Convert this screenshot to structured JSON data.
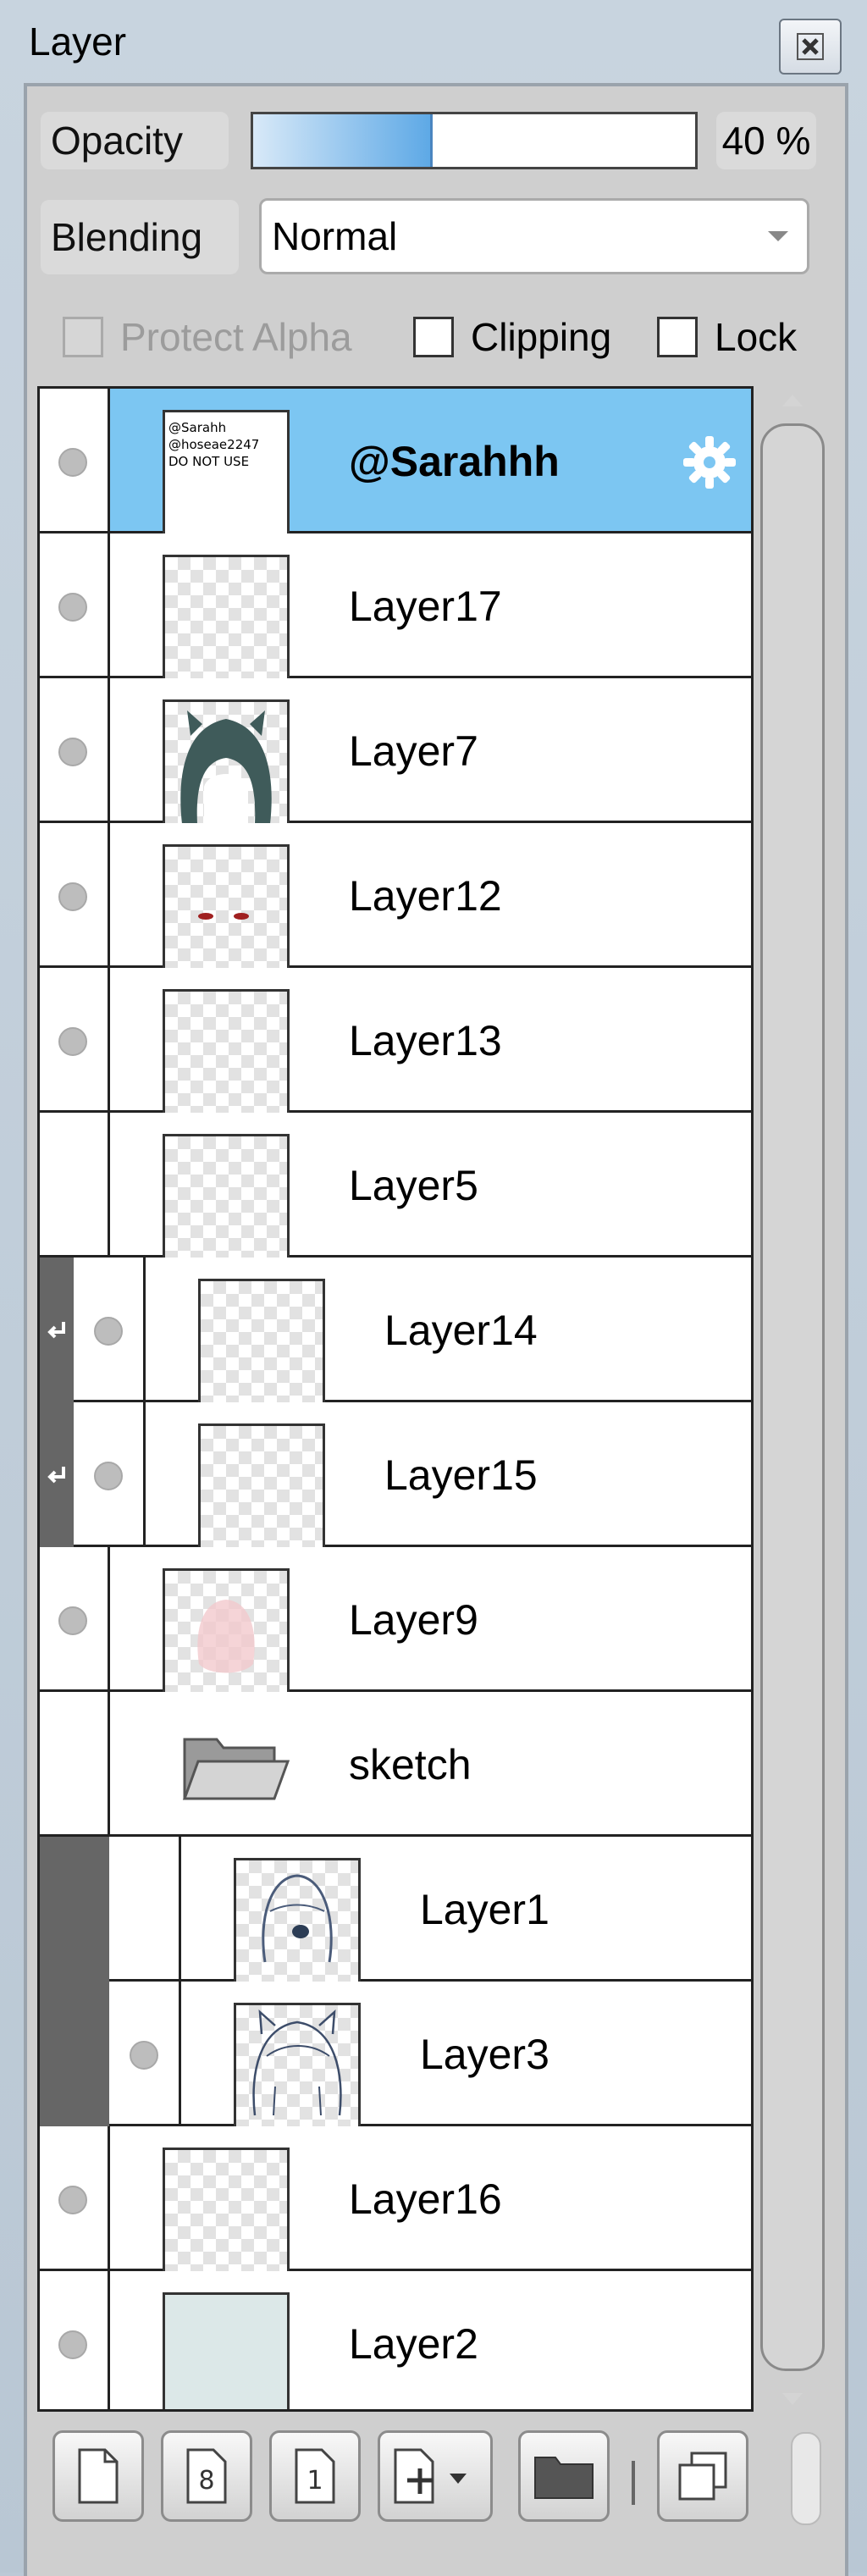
{
  "window": {
    "title": "Layer"
  },
  "controls": {
    "opacity_label": "Opacity",
    "opacity_value": "40 %",
    "opacity_fraction": 0.4,
    "blending_label": "Blending",
    "blending_value": "Normal",
    "protect_alpha_label": "Protect Alpha",
    "clipping_label": "Clipping",
    "lock_label": "Lock"
  },
  "layers": [
    {
      "name": "@Sarahhh",
      "selected": true,
      "visible": true
    },
    {
      "name": "Layer17",
      "visible": true
    },
    {
      "name": "Layer7",
      "visible": true
    },
    {
      "name": "Layer12",
      "visible": true
    },
    {
      "name": "Layer13",
      "visible": true
    },
    {
      "name": "Layer5",
      "visible": false
    },
    {
      "name": "Layer14",
      "visible": true,
      "clipped": true
    },
    {
      "name": "Layer15",
      "visible": true,
      "clipped": true
    },
    {
      "name": "Layer9",
      "visible": true
    },
    {
      "name": "sketch",
      "visible": false,
      "folder": true
    },
    {
      "name": "Layer1",
      "visible": false,
      "in_folder": true
    },
    {
      "name": "Layer3",
      "visible": true,
      "in_folder": true
    },
    {
      "name": "Layer16",
      "visible": true
    },
    {
      "name": "Layer2",
      "visible": true
    }
  ],
  "watermark_lines": [
    "@Sarahh",
    "@hoseae2247",
    "DO NOT USE"
  ],
  "toolbar": {
    "icons": [
      "new-layer-icon",
      "new-8bit-layer-icon",
      "new-1bit-layer-icon",
      "add-special-layer-icon",
      "new-folder-icon",
      "duplicate-layer-icon"
    ],
    "btn8": "8",
    "btn1": "1"
  },
  "colors": {
    "selection": "#7cc6f2",
    "opacity_fill": "#5ea9e6"
  }
}
